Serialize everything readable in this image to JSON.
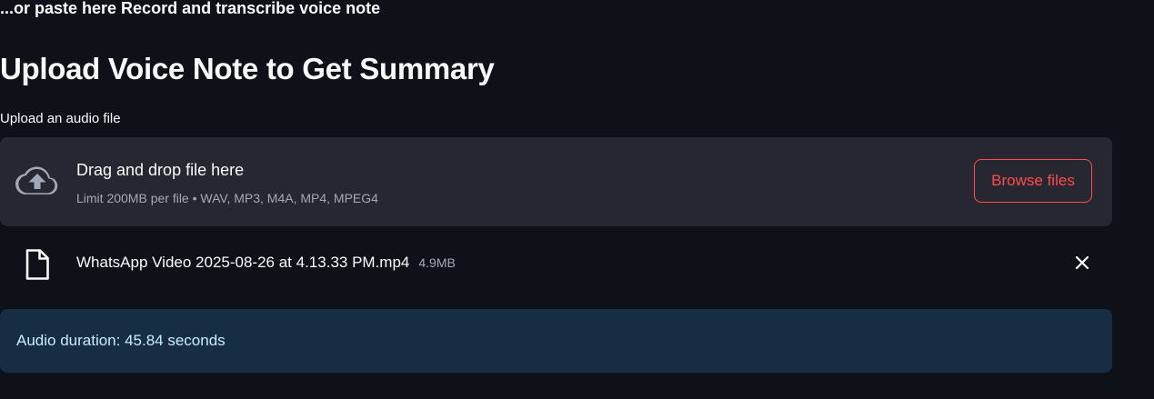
{
  "header": {
    "top_heading": "...or paste here Record and transcribe voice note",
    "title": "Upload Voice Note to Get Summary"
  },
  "uploader": {
    "label": "Upload an audio file",
    "dropzone_title": "Drag and drop file here",
    "dropzone_subtitle": "Limit 200MB per file • WAV, MP3, M4A, MP4, MPEG4",
    "browse_label": "Browse files",
    "upload_icon": "cloud-upload-icon",
    "accent_color": "#ff4b4b"
  },
  "uploaded_file": {
    "name": "WhatsApp Video 2025-08-26 at 4.13.33 PM.mp4",
    "size": "4.9MB",
    "file_icon": "file-icon",
    "remove_icon": "close-icon"
  },
  "info": {
    "text": "Audio duration: 45.84 seconds",
    "background_color": "#172d43",
    "text_color": "#c7ebff"
  }
}
